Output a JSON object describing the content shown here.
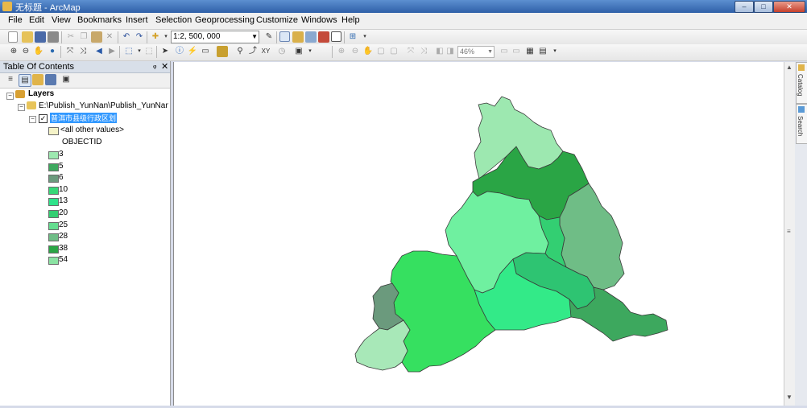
{
  "window": {
    "title": "无标题 - ArcMap",
    "minimize": "–",
    "maximize": "□",
    "close": "✕"
  },
  "menu": [
    "File",
    "Edit",
    "View",
    "Bookmarks",
    "Insert",
    "Selection",
    "Geoprocessing",
    "Customize",
    "Windows",
    "Help"
  ],
  "toolbar": {
    "scale": "1:2, 500, 000",
    "zoom_percent": "46%"
  },
  "toc": {
    "title": "Table Of Contents",
    "pin": "ᵩ",
    "close": "✕",
    "layers_label": "Layers",
    "source_path": "E:\\Publish_YunNan\\Publish_YunNan\\Da",
    "layer_name": "普洱市县级行政区划",
    "other_values": "<all other values>",
    "field": "OBJECTID",
    "classes": [
      {
        "label": "3",
        "color": "#9de8b0"
      },
      {
        "label": "5",
        "color": "#3da85e"
      },
      {
        "label": "6",
        "color": "#6b9a7d"
      },
      {
        "label": "10",
        "color": "#36d877"
      },
      {
        "label": "13",
        "color": "#2ee38a"
      },
      {
        "label": "20",
        "color": "#33cf72"
      },
      {
        "label": "25",
        "color": "#64dd8f"
      },
      {
        "label": "28",
        "color": "#6fbd86"
      },
      {
        "label": "38",
        "color": "#2aa545"
      },
      {
        "label": "54",
        "color": "#8be3a3"
      }
    ],
    "other_color": "#f5f3c8"
  },
  "map": {
    "regions": [
      {
        "name": "region-north",
        "color": "#9de8b0"
      },
      {
        "name": "region-upper-band",
        "color": "#2aa545"
      },
      {
        "name": "region-east-upper",
        "color": "#6fbd86"
      },
      {
        "name": "region-center",
        "color": "#6ff0a0"
      },
      {
        "name": "region-middle-small",
        "color": "#33cf72"
      },
      {
        "name": "region-center-east",
        "color": "#2ec472"
      },
      {
        "name": "region-west",
        "color": "#36e060"
      },
      {
        "name": "region-south-center",
        "color": "#33ea88"
      },
      {
        "name": "region-southeast",
        "color": "#3da85e"
      },
      {
        "name": "region-far-west",
        "color": "#6b9a7d"
      },
      {
        "name": "region-southwest",
        "color": "#a8e8b8"
      }
    ]
  },
  "dock": {
    "catalog": "Catalog",
    "search": "Search"
  }
}
